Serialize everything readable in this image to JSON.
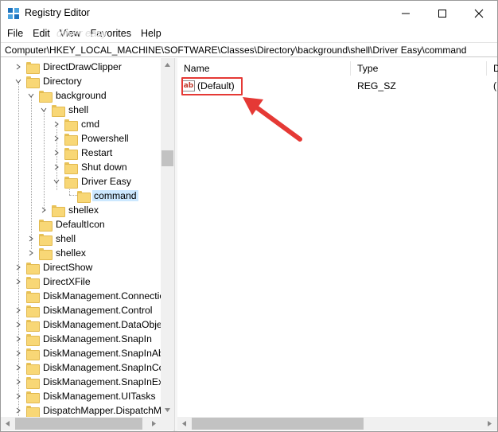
{
  "window": {
    "title": "Registry Editor",
    "icons": {
      "app": "registry-icon",
      "minimize": "minimize-icon",
      "maximize": "maximize-icon",
      "close": "close-icon"
    }
  },
  "menu": [
    "File",
    "Edit",
    "View",
    "Favorites",
    "Help"
  ],
  "watermark": "driver easy",
  "address": "Computer\\HKEY_LOCAL_MACHINE\\SOFTWARE\\Classes\\Directory\\background\\shell\\Driver Easy\\command",
  "tree": {
    "items": [
      {
        "label": "DirectDrawClipper",
        "expander": "collapsed"
      },
      {
        "label": "Directory",
        "expander": "expanded"
      },
      {
        "label": "background",
        "expander": "expanded"
      },
      {
        "label": "shell",
        "expander": "expanded"
      },
      {
        "label": "cmd",
        "expander": "collapsed"
      },
      {
        "label": "Powershell",
        "expander": "collapsed"
      },
      {
        "label": "Restart",
        "expander": "collapsed"
      },
      {
        "label": "Shut down",
        "expander": "collapsed"
      },
      {
        "label": "Driver Easy",
        "expander": "expanded"
      },
      {
        "label": "command",
        "expander": "none",
        "selected": true
      },
      {
        "label": "shellex",
        "expander": "collapsed"
      },
      {
        "label": "DefaultIcon",
        "expander": "none"
      },
      {
        "label": "shell",
        "expander": "collapsed"
      },
      {
        "label": "shellex",
        "expander": "collapsed"
      },
      {
        "label": "DirectShow",
        "expander": "collapsed"
      },
      {
        "label": "DirectXFile",
        "expander": "collapsed"
      },
      {
        "label": "DiskManagement.Connectio",
        "expander": "none"
      },
      {
        "label": "DiskManagement.Control",
        "expander": "collapsed"
      },
      {
        "label": "DiskManagement.DataObje",
        "expander": "collapsed"
      },
      {
        "label": "DiskManagement.SnapIn",
        "expander": "collapsed"
      },
      {
        "label": "DiskManagement.SnapInAb",
        "expander": "collapsed"
      },
      {
        "label": "DiskManagement.SnapInCo",
        "expander": "collapsed"
      },
      {
        "label": "DiskManagement.SnapInExt",
        "expander": "collapsed"
      },
      {
        "label": "DiskManagement.UITasks",
        "expander": "collapsed"
      },
      {
        "label": "DispatchMapper.DispatchM",
        "expander": "collapsed"
      }
    ]
  },
  "values": {
    "columns": {
      "name": "Name",
      "type": "Type",
      "data": "D"
    },
    "rows": [
      {
        "name": "(Default)",
        "type": "REG_SZ",
        "data": "(",
        "icon": "string-value-icon"
      }
    ]
  },
  "colors": {
    "selection": "#cce8ff",
    "annotation": "#e53935",
    "folder": "#f8d776"
  }
}
